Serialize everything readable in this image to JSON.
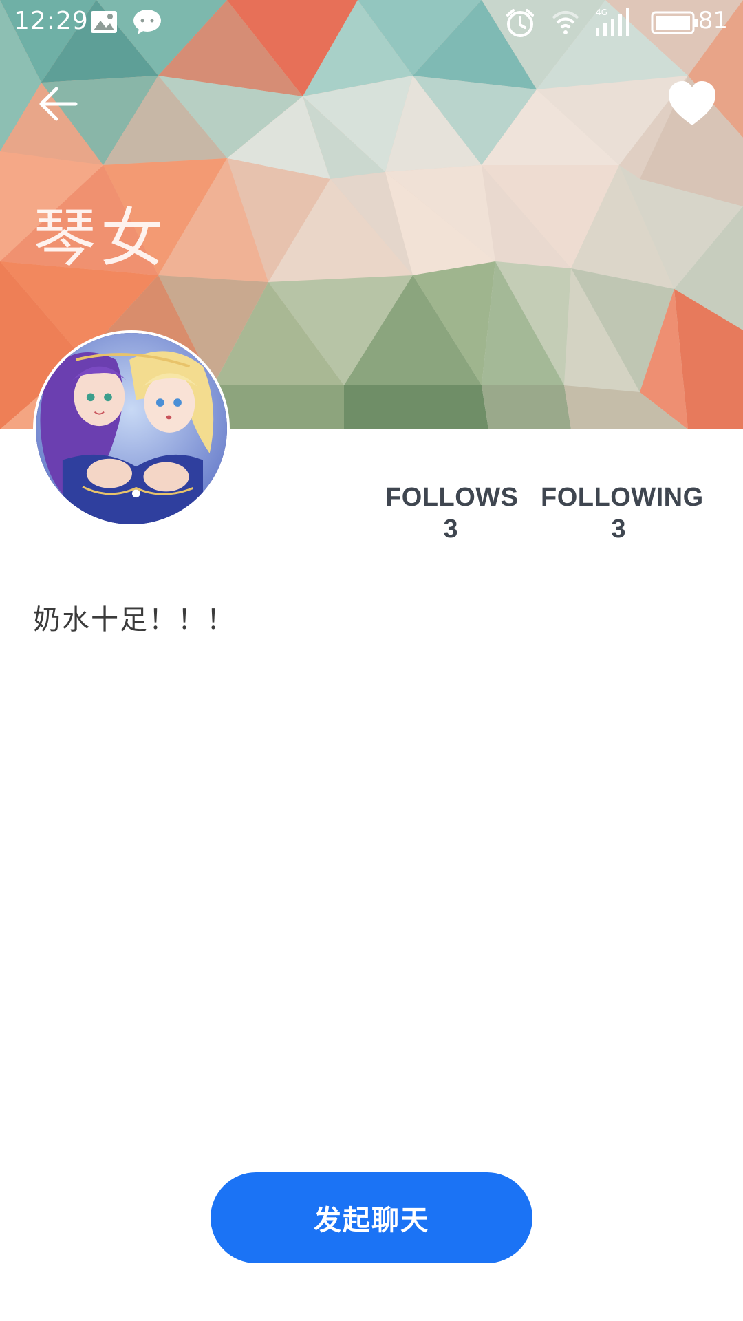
{
  "status_bar": {
    "time": "12:29",
    "battery": "81",
    "icons": [
      "image-notification-icon",
      "wechat-icon",
      "alarm-icon",
      "wifi-icon",
      "signal-4g-icon",
      "battery-icon"
    ],
    "network_label": "4G"
  },
  "toolbar": {
    "back_icon": "arrow-back-icon",
    "favorite_icon": "heart-icon"
  },
  "profile": {
    "name": "琴女",
    "bio": "奶水十足！！！"
  },
  "stats": {
    "follows_label": "FOLLOWS",
    "follows_value": "3",
    "following_label": "FOLLOWING",
    "following_value": "3"
  },
  "actions": {
    "start_chat_label": "发起聊天"
  },
  "colors": {
    "primary_button": "#1b73f5",
    "stat_text": "#3f4650",
    "bio_text": "#3b3b3b"
  }
}
